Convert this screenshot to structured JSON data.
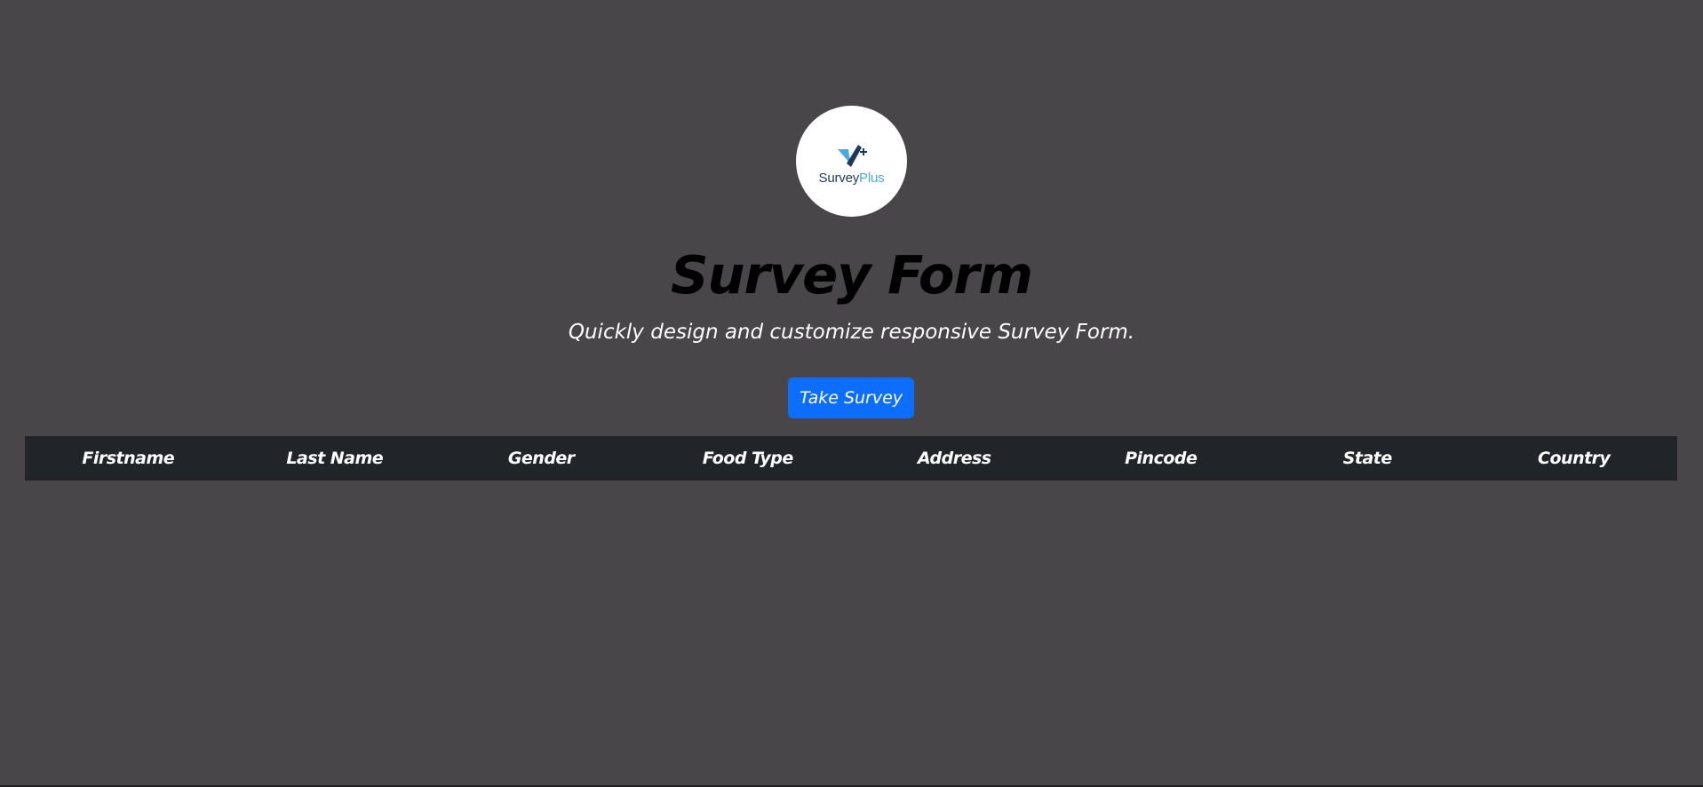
{
  "logo": {
    "text_part_a": "Survey",
    "text_part_b": "Plus",
    "icon": "checkmark-plus-icon",
    "colors": {
      "dark": "#1d3a5c",
      "light": "#4aa8de"
    }
  },
  "header": {
    "title": "Survey Form",
    "subtitle": "Quickly design and customize responsive Survey Form."
  },
  "actions": {
    "take_survey_label": "Take Survey"
  },
  "table": {
    "columns": [
      "Firstname",
      "Last Name",
      "Gender",
      "Food Type",
      "Address",
      "Pincode",
      "State",
      "Country"
    ],
    "rows": []
  },
  "colors": {
    "background": "#484648",
    "accent": "#0d6efd",
    "table_header": "#212529"
  }
}
